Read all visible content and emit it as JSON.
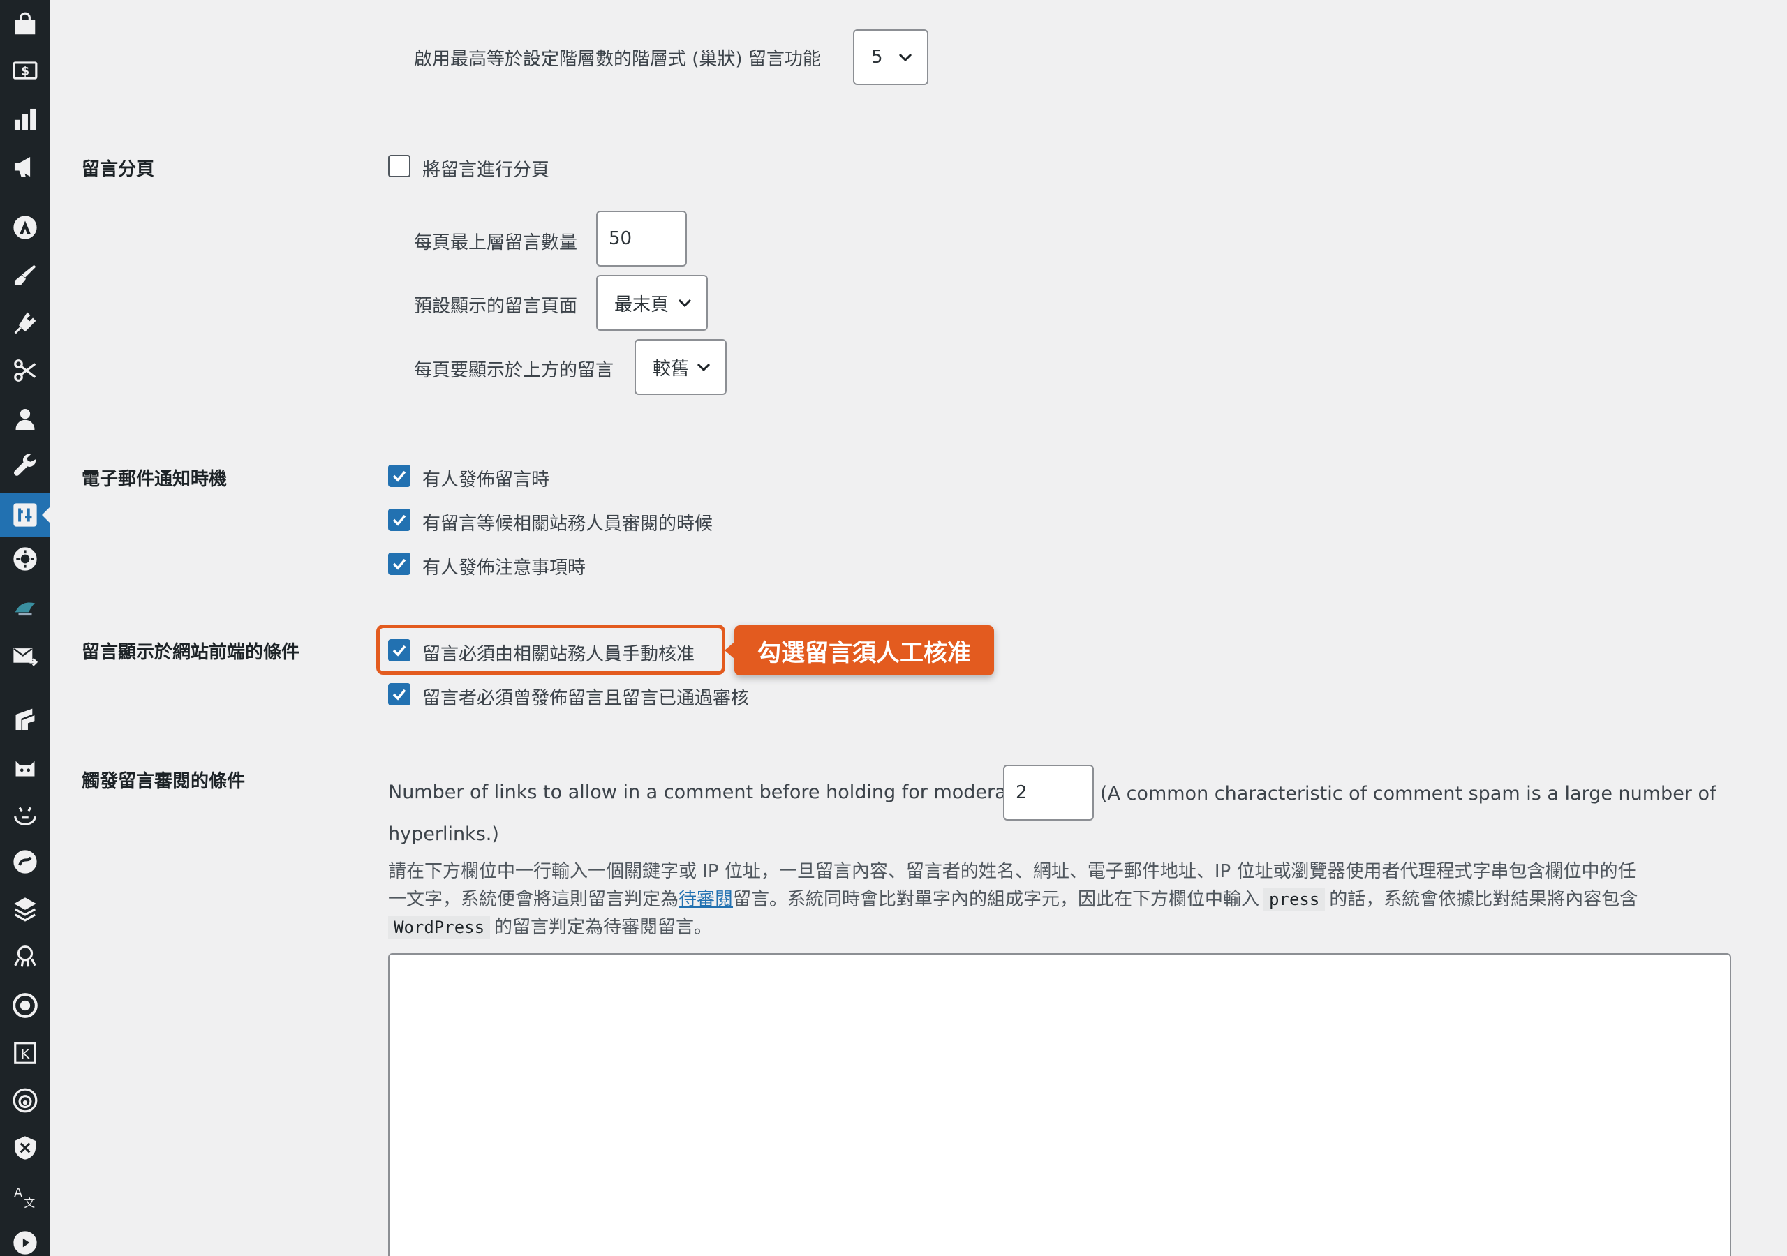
{
  "sidebar": {
    "items": [
      {
        "icon": "shop-bag-icon"
      },
      {
        "icon": "dollar-icon"
      },
      {
        "icon": "bar-chart-icon"
      },
      {
        "icon": "megaphone-icon"
      },
      {
        "icon": "astra-icon"
      },
      {
        "icon": "paintbrush-icon"
      },
      {
        "icon": "plugin-icon"
      },
      {
        "icon": "scissors-icon"
      },
      {
        "icon": "user-icon"
      },
      {
        "icon": "wrench-icon"
      },
      {
        "icon": "settings-sliders-icon",
        "active": true
      },
      {
        "icon": "gear-circle-icon"
      },
      {
        "icon": "bird-icon"
      },
      {
        "icon": "mail-arrow-icon"
      },
      {
        "icon": "layers-icon"
      },
      {
        "icon": "cat-icon"
      },
      {
        "icon": "face-icon"
      },
      {
        "icon": "swirl-icon"
      },
      {
        "icon": "stack-icon"
      },
      {
        "icon": "octopus-icon"
      },
      {
        "icon": "eye-circle-icon"
      },
      {
        "icon": "boxed-letter-icon"
      },
      {
        "icon": "broadcast-icon"
      },
      {
        "icon": "shield-icon"
      },
      {
        "icon": "translate-icon"
      },
      {
        "icon": "play-icon"
      }
    ]
  },
  "thread": {
    "label": "啟用最高等於設定階層數的階層式 (巢狀) 留言功能",
    "depth_value": "5"
  },
  "paging": {
    "section_label": "留言分頁",
    "enable_label": "將留言進行分頁",
    "enable_checked": false,
    "per_page_label": "每頁最上層留言數量",
    "per_page_value": "50",
    "default_page_label": "預設顯示的留言頁面",
    "default_page_value": "最末頁",
    "order_label": "每頁要顯示於上方的留言",
    "order_value": "較舊"
  },
  "email": {
    "section_label": "電子郵件通知時機",
    "options": [
      {
        "label": "有人發佈留言時",
        "checked": true
      },
      {
        "label": "有留言等候相關站務人員審閱的時候",
        "checked": true
      },
      {
        "label": "有人發佈注意事項時",
        "checked": true
      }
    ]
  },
  "appear": {
    "section_label": "留言顯示於網站前端的條件",
    "options": [
      {
        "label": "留言必須由相關站務人員手動核准",
        "checked": true
      },
      {
        "label": "留言者必須曾發佈留言且留言已通過審核",
        "checked": true
      }
    ],
    "callout": "勾選留言須人工核准"
  },
  "moderation": {
    "section_label": "觸發留言審閱的條件",
    "links_label": "Number of links to allow in a comment before holding for moderation:",
    "links_value": "2",
    "links_note_1": "(A common characteristic of comment spam is a large number of",
    "links_note_2": "hyperlinks.)",
    "desc_1": "請在下方欄位中一行輸入一個關鍵字或 IP 位址，一旦留言內容、留言者的姓名、網址、電子郵件地址、IP 位址或瀏覽器使用者代理程式字串包含欄位中的任",
    "desc_2a": "一文字，系統便會將這則留言判定為",
    "desc_2_link": "待審閱",
    "desc_2b": "留言。系統同時會比對單字內的組成字元，因此在下方欄位中輸入",
    "desc_code_1": "press",
    "desc_2c": "的話，系統會依據比對結果將內容包含",
    "desc_code_2": "WordPress",
    "desc_3": "的留言判定為待審閱留言。",
    "keys_value": ""
  },
  "colors": {
    "accent": "#2271b1",
    "callout": "#e35b1f",
    "sidebar": "#1d2327",
    "background": "#f0f0f1"
  }
}
